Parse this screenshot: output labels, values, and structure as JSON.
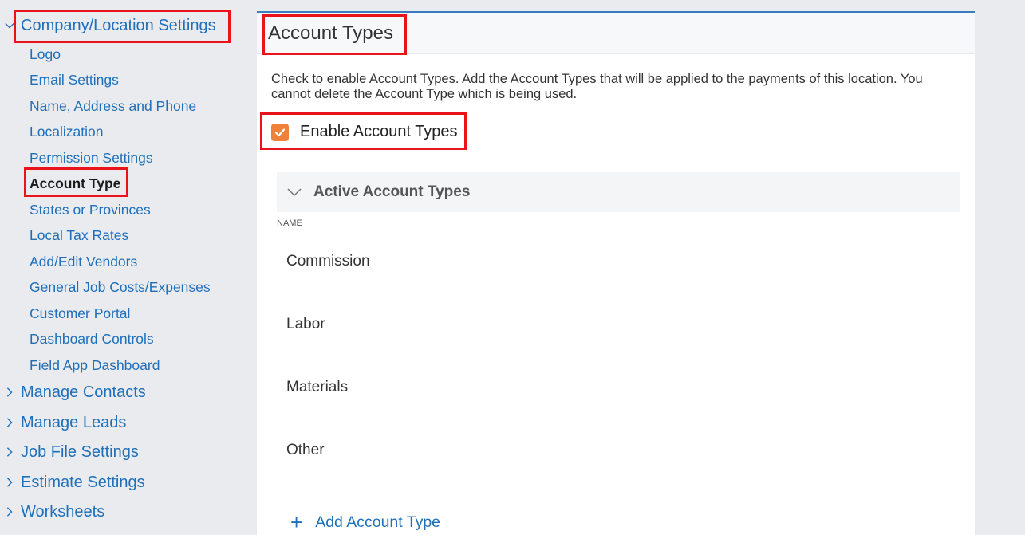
{
  "sidebar": {
    "company_section": "Company/Location Settings",
    "sub_items": [
      "Logo",
      "Email Settings",
      "Name, Address and Phone",
      "Localization",
      "Permission Settings",
      "Account Type",
      "States or Provinces",
      "Local Tax Rates",
      "Add/Edit Vendors",
      "General Job Costs/Expenses",
      "Customer Portal",
      "Dashboard Controls",
      "Field App Dashboard"
    ],
    "active_item": "Account Type",
    "other_sections": [
      "Manage Contacts",
      "Manage Leads",
      "Job File Settings",
      "Estimate Settings",
      "Worksheets"
    ]
  },
  "main": {
    "title": "Account Types",
    "description": "Check to enable Account Types. Add the Account Types that will be applied to the payments of this location. You cannot delete the Account Type which is being used.",
    "enable_checkbox": {
      "label": "Enable Account Types",
      "checked": true
    },
    "panel": {
      "title": "Active Account Types",
      "column_header": "NAME",
      "rows": [
        "Commission",
        "Labor",
        "Materials",
        "Other"
      ]
    },
    "add_button_label": "Add Account Type"
  },
  "colors": {
    "link": "#1f6fba",
    "highlight": "#e8141a",
    "checkbox": "#f0813a",
    "accent_border": "#3b7bbf"
  },
  "icons": {
    "expanded": "chevron-down-icon",
    "collapsed": "chevron-right-icon",
    "check": "check-icon",
    "add": "plus-icon"
  }
}
